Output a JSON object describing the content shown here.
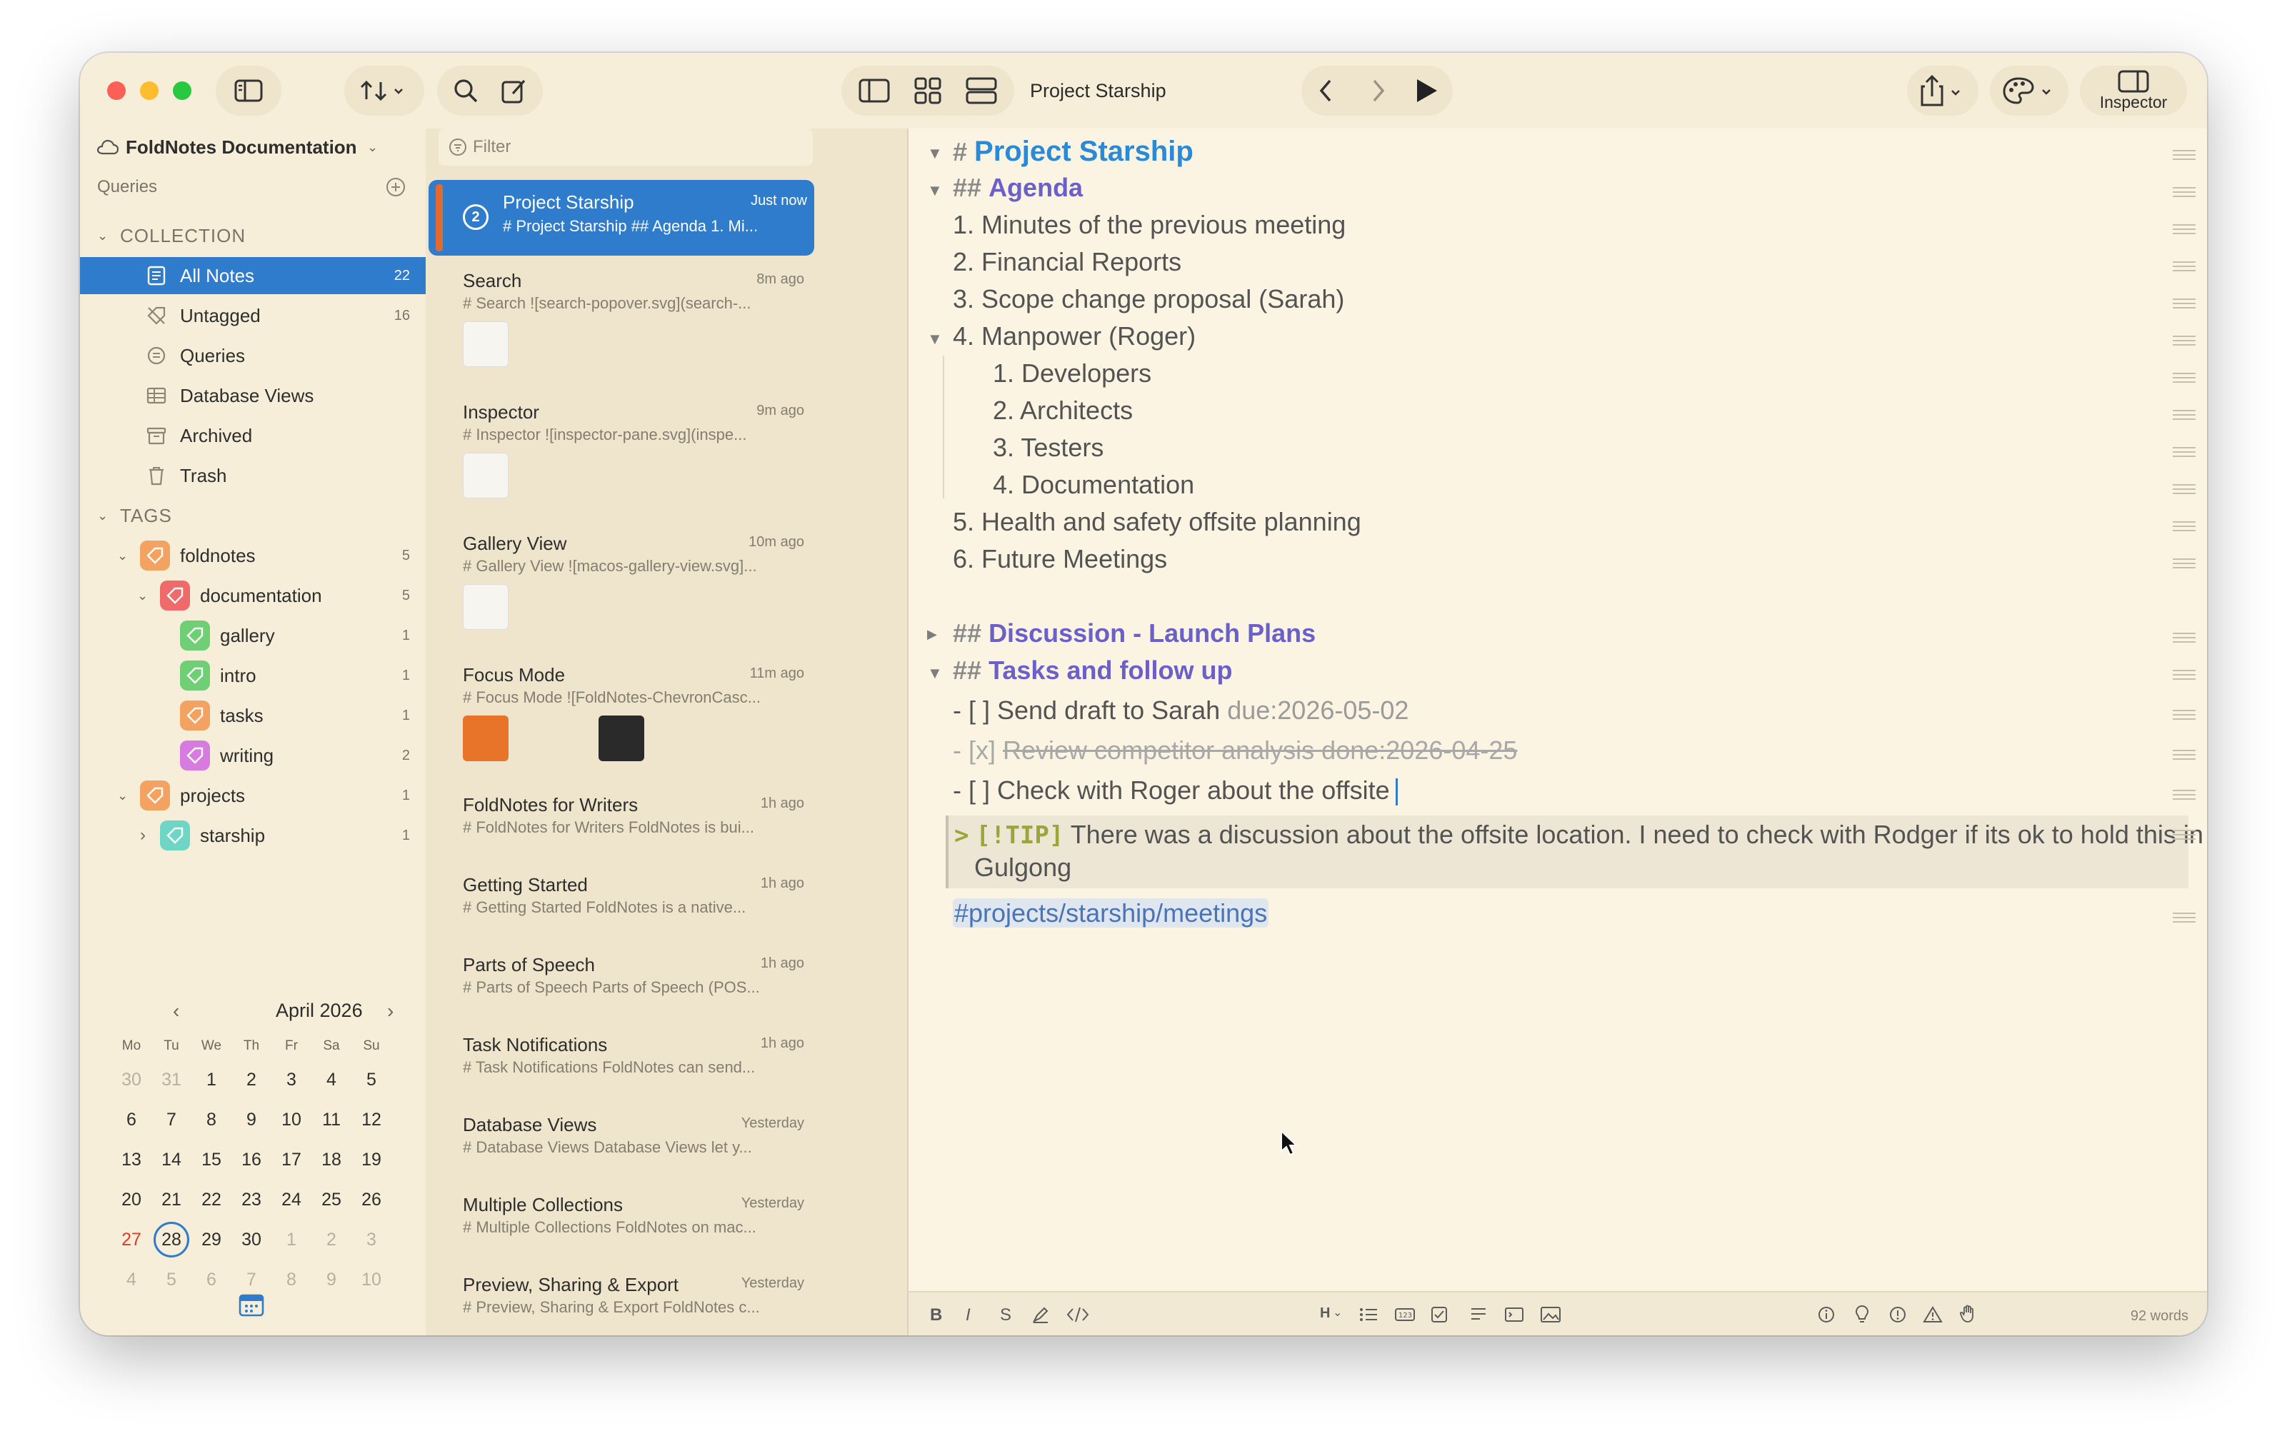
{
  "toolbar": {
    "title": "Project Starship",
    "inspector_label": "Inspector"
  },
  "sidebar": {
    "collection_name": "FoldNotes Documentation",
    "queries_label": "Queries",
    "collection_header": "COLLECTION",
    "items": [
      {
        "label": "All Notes",
        "count": "22"
      },
      {
        "label": "Untagged",
        "count": "16"
      },
      {
        "label": "Queries",
        "count": ""
      },
      {
        "label": "Database Views",
        "count": ""
      },
      {
        "label": "Archived",
        "count": ""
      },
      {
        "label": "Trash",
        "count": ""
      }
    ],
    "tags_header": "TAGS",
    "tags": [
      {
        "label": "foldnotes",
        "count": "5",
        "color": "#f4a261"
      },
      {
        "label": "documentation",
        "count": "5",
        "color": "#ef6b6b"
      },
      {
        "label": "gallery",
        "count": "1",
        "color": "#6fcf74"
      },
      {
        "label": "intro",
        "count": "1",
        "color": "#6fcf74"
      },
      {
        "label": "tasks",
        "count": "1",
        "color": "#f4a261"
      },
      {
        "label": "writing",
        "count": "2",
        "color": "#d77be0"
      },
      {
        "label": "projects",
        "count": "1",
        "color": "#f4a261"
      },
      {
        "label": "starship",
        "count": "1",
        "color": "#6fd6c6"
      }
    ]
  },
  "calendar": {
    "month": "April 2026",
    "dow": [
      "Mo",
      "Tu",
      "We",
      "Th",
      "Fr",
      "Sa",
      "Su"
    ],
    "weeks": [
      [
        "30",
        "31",
        "1",
        "2",
        "3",
        "4",
        "5"
      ],
      [
        "6",
        "7",
        "8",
        "9",
        "10",
        "11",
        "12"
      ],
      [
        "13",
        "14",
        "15",
        "16",
        "17",
        "18",
        "19"
      ],
      [
        "20",
        "21",
        "22",
        "23",
        "24",
        "25",
        "26"
      ],
      [
        "27",
        "28",
        "29",
        "30",
        "1",
        "2",
        "3"
      ],
      [
        "4",
        "5",
        "6",
        "7",
        "8",
        "9",
        "10"
      ]
    ]
  },
  "notelist": {
    "filter_placeholder": "Filter",
    "selected_badge": "2",
    "notes": [
      {
        "title": "Project Starship",
        "time": "Just now",
        "preview": "# Project Starship ## Agenda 1. Mi..."
      },
      {
        "title": "Search",
        "time": "8m ago",
        "preview": "# Search ![search-popover.svg](search-..."
      },
      {
        "title": "Inspector",
        "time": "9m ago",
        "preview": "# Inspector ![inspector-pane.svg](inspe..."
      },
      {
        "title": "Gallery View",
        "time": "10m ago",
        "preview": "# Gallery View ![macos-gallery-view.svg]..."
      },
      {
        "title": "Focus Mode",
        "time": "11m ago",
        "preview": "# Focus Mode ![FoldNotes-ChevronCasc..."
      },
      {
        "title": "FoldNotes for Writers",
        "time": "1h ago",
        "preview": "# FoldNotes for Writers  FoldNotes is bui..."
      },
      {
        "title": "Getting Started",
        "time": "1h ago",
        "preview": "# Getting Started  FoldNotes is a native..."
      },
      {
        "title": "Parts of Speech",
        "time": "1h ago",
        "preview": "# Parts of Speech  Parts of Speech (POS..."
      },
      {
        "title": "Task Notifications",
        "time": "1h ago",
        "preview": "# Task Notifications  FoldNotes can send..."
      },
      {
        "title": "Database Views",
        "time": "Yesterday",
        "preview": "# Database Views  Database Views let y..."
      },
      {
        "title": "Multiple Collections",
        "time": "Yesterday",
        "preview": "# Multiple Collections  FoldNotes on mac..."
      },
      {
        "title": "Preview, Sharing & Export",
        "time": "Yesterday",
        "preview": "# Preview, Sharing & Export  FoldNotes c..."
      }
    ]
  },
  "editor": {
    "h1_mark": "#",
    "h1": "Project Starship",
    "h2_mark": "##",
    "agenda": "Agenda",
    "agenda_items": [
      "1. Minutes of the previous meeting",
      "2. Financial Reports",
      "3. Scope change proposal (Sarah)",
      "4. Manpower (Roger)"
    ],
    "manpower_items": [
      "1. Developers",
      "2. Architects",
      "3. Testers",
      "4. Documentation"
    ],
    "agenda_items_2": [
      "5. Health and safety offsite planning",
      "6. Future Meetings"
    ],
    "discussion": "Discussion -  Launch Plans",
    "tasks": "Tasks and follow up",
    "task1": "- [ ] Send draft to Sarah",
    "task1_due": "due:2026-05-02",
    "task2_prefix": "- [x]",
    "task2": "Review competitor analysis done:2026-04-25",
    "task3": "- [ ] Check with Roger about the offsite",
    "tip_gt": ">",
    "tip_tag": "[!TIP]",
    "tip_text_1": "There was a discussion about the offsite location. I need to check with Rodger if its ok to hold this in",
    "tip_text_2": "Gulgong",
    "hashtag": "#projects/starship/meetings"
  },
  "bottombar": {
    "bold": "B",
    "italic": "I",
    "strike": "S",
    "heading": "H",
    "words": "92 words"
  },
  "colors": {
    "accent": "#2f7bcc",
    "window_bg": "#f6eed9",
    "editor_bg": "#fbf4e2",
    "h1": "#2a8ad6",
    "h2": "#6b5fc8"
  }
}
